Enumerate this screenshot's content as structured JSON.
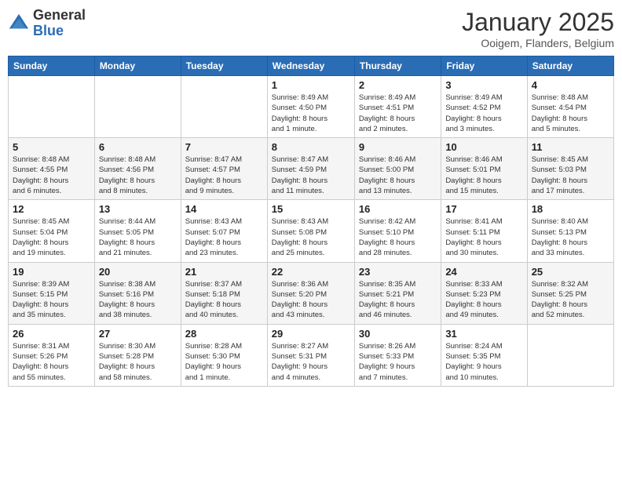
{
  "logo": {
    "general": "General",
    "blue": "Blue"
  },
  "title": "January 2025",
  "location": "Ooigem, Flanders, Belgium",
  "days_header": [
    "Sunday",
    "Monday",
    "Tuesday",
    "Wednesday",
    "Thursday",
    "Friday",
    "Saturday"
  ],
  "weeks": [
    [
      {
        "day": "",
        "info": ""
      },
      {
        "day": "",
        "info": ""
      },
      {
        "day": "",
        "info": ""
      },
      {
        "day": "1",
        "info": "Sunrise: 8:49 AM\nSunset: 4:50 PM\nDaylight: 8 hours\nand 1 minute."
      },
      {
        "day": "2",
        "info": "Sunrise: 8:49 AM\nSunset: 4:51 PM\nDaylight: 8 hours\nand 2 minutes."
      },
      {
        "day": "3",
        "info": "Sunrise: 8:49 AM\nSunset: 4:52 PM\nDaylight: 8 hours\nand 3 minutes."
      },
      {
        "day": "4",
        "info": "Sunrise: 8:48 AM\nSunset: 4:54 PM\nDaylight: 8 hours\nand 5 minutes."
      }
    ],
    [
      {
        "day": "5",
        "info": "Sunrise: 8:48 AM\nSunset: 4:55 PM\nDaylight: 8 hours\nand 6 minutes."
      },
      {
        "day": "6",
        "info": "Sunrise: 8:48 AM\nSunset: 4:56 PM\nDaylight: 8 hours\nand 8 minutes."
      },
      {
        "day": "7",
        "info": "Sunrise: 8:47 AM\nSunset: 4:57 PM\nDaylight: 8 hours\nand 9 minutes."
      },
      {
        "day": "8",
        "info": "Sunrise: 8:47 AM\nSunset: 4:59 PM\nDaylight: 8 hours\nand 11 minutes."
      },
      {
        "day": "9",
        "info": "Sunrise: 8:46 AM\nSunset: 5:00 PM\nDaylight: 8 hours\nand 13 minutes."
      },
      {
        "day": "10",
        "info": "Sunrise: 8:46 AM\nSunset: 5:01 PM\nDaylight: 8 hours\nand 15 minutes."
      },
      {
        "day": "11",
        "info": "Sunrise: 8:45 AM\nSunset: 5:03 PM\nDaylight: 8 hours\nand 17 minutes."
      }
    ],
    [
      {
        "day": "12",
        "info": "Sunrise: 8:45 AM\nSunset: 5:04 PM\nDaylight: 8 hours\nand 19 minutes."
      },
      {
        "day": "13",
        "info": "Sunrise: 8:44 AM\nSunset: 5:05 PM\nDaylight: 8 hours\nand 21 minutes."
      },
      {
        "day": "14",
        "info": "Sunrise: 8:43 AM\nSunset: 5:07 PM\nDaylight: 8 hours\nand 23 minutes."
      },
      {
        "day": "15",
        "info": "Sunrise: 8:43 AM\nSunset: 5:08 PM\nDaylight: 8 hours\nand 25 minutes."
      },
      {
        "day": "16",
        "info": "Sunrise: 8:42 AM\nSunset: 5:10 PM\nDaylight: 8 hours\nand 28 minutes."
      },
      {
        "day": "17",
        "info": "Sunrise: 8:41 AM\nSunset: 5:11 PM\nDaylight: 8 hours\nand 30 minutes."
      },
      {
        "day": "18",
        "info": "Sunrise: 8:40 AM\nSunset: 5:13 PM\nDaylight: 8 hours\nand 33 minutes."
      }
    ],
    [
      {
        "day": "19",
        "info": "Sunrise: 8:39 AM\nSunset: 5:15 PM\nDaylight: 8 hours\nand 35 minutes."
      },
      {
        "day": "20",
        "info": "Sunrise: 8:38 AM\nSunset: 5:16 PM\nDaylight: 8 hours\nand 38 minutes."
      },
      {
        "day": "21",
        "info": "Sunrise: 8:37 AM\nSunset: 5:18 PM\nDaylight: 8 hours\nand 40 minutes."
      },
      {
        "day": "22",
        "info": "Sunrise: 8:36 AM\nSunset: 5:20 PM\nDaylight: 8 hours\nand 43 minutes."
      },
      {
        "day": "23",
        "info": "Sunrise: 8:35 AM\nSunset: 5:21 PM\nDaylight: 8 hours\nand 46 minutes."
      },
      {
        "day": "24",
        "info": "Sunrise: 8:33 AM\nSunset: 5:23 PM\nDaylight: 8 hours\nand 49 minutes."
      },
      {
        "day": "25",
        "info": "Sunrise: 8:32 AM\nSunset: 5:25 PM\nDaylight: 8 hours\nand 52 minutes."
      }
    ],
    [
      {
        "day": "26",
        "info": "Sunrise: 8:31 AM\nSunset: 5:26 PM\nDaylight: 8 hours\nand 55 minutes."
      },
      {
        "day": "27",
        "info": "Sunrise: 8:30 AM\nSunset: 5:28 PM\nDaylight: 8 hours\nand 58 minutes."
      },
      {
        "day": "28",
        "info": "Sunrise: 8:28 AM\nSunset: 5:30 PM\nDaylight: 9 hours\nand 1 minute."
      },
      {
        "day": "29",
        "info": "Sunrise: 8:27 AM\nSunset: 5:31 PM\nDaylight: 9 hours\nand 4 minutes."
      },
      {
        "day": "30",
        "info": "Sunrise: 8:26 AM\nSunset: 5:33 PM\nDaylight: 9 hours\nand 7 minutes."
      },
      {
        "day": "31",
        "info": "Sunrise: 8:24 AM\nSunset: 5:35 PM\nDaylight: 9 hours\nand 10 minutes."
      },
      {
        "day": "",
        "info": ""
      }
    ]
  ]
}
